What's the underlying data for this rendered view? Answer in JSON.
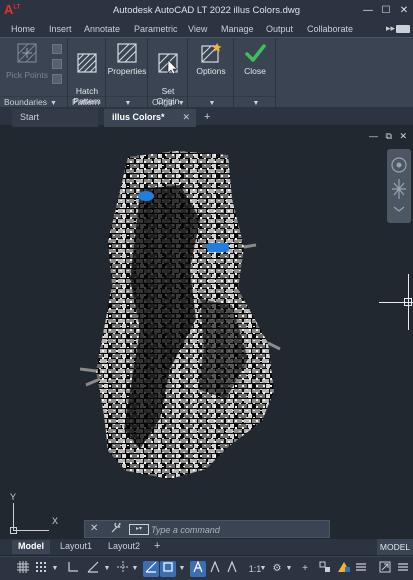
{
  "window": {
    "title": "Autodesk AutoCAD LT 2022    illus Colors.dwg",
    "logo_text": "A",
    "logo_sup": "LT",
    "controls": [
      "—",
      "☐",
      "✕"
    ]
  },
  "menu": {
    "items": [
      "Home",
      "Insert",
      "Annotate",
      "Parametric",
      "View",
      "Manage",
      "Output",
      "Collaborate"
    ],
    "more": "▸▸"
  },
  "ribbon": {
    "pick_points": "Pick Points",
    "hatch_pattern": "Hatch\nPattern",
    "properties": "Properties",
    "set_origin": "Set\nOrigin",
    "options": "Options",
    "close": "Close",
    "footers": {
      "boundaries": "Boundaries",
      "pattern": "Pattern",
      "origin": "Origin"
    }
  },
  "doc_tabs": {
    "start": "Start",
    "active": "illus Colors*",
    "close": "✕",
    "add": "+"
  },
  "viewport": {
    "controls": [
      "—",
      "⧉",
      "✕"
    ]
  },
  "ucs": {
    "y": "Y",
    "x": "X"
  },
  "command": {
    "close": "✕",
    "wrench": "🔧",
    "placeholder": "Type a command"
  },
  "layouts": {
    "tabs": [
      "Model",
      "Layout1",
      "Layout2"
    ],
    "add": "+",
    "mode": "MODEL"
  },
  "status": {
    "scale": "1:1"
  },
  "colors": {
    "accent": "#3b6fb3",
    "close_green": "#3fbf5b",
    "background": "#212830"
  }
}
